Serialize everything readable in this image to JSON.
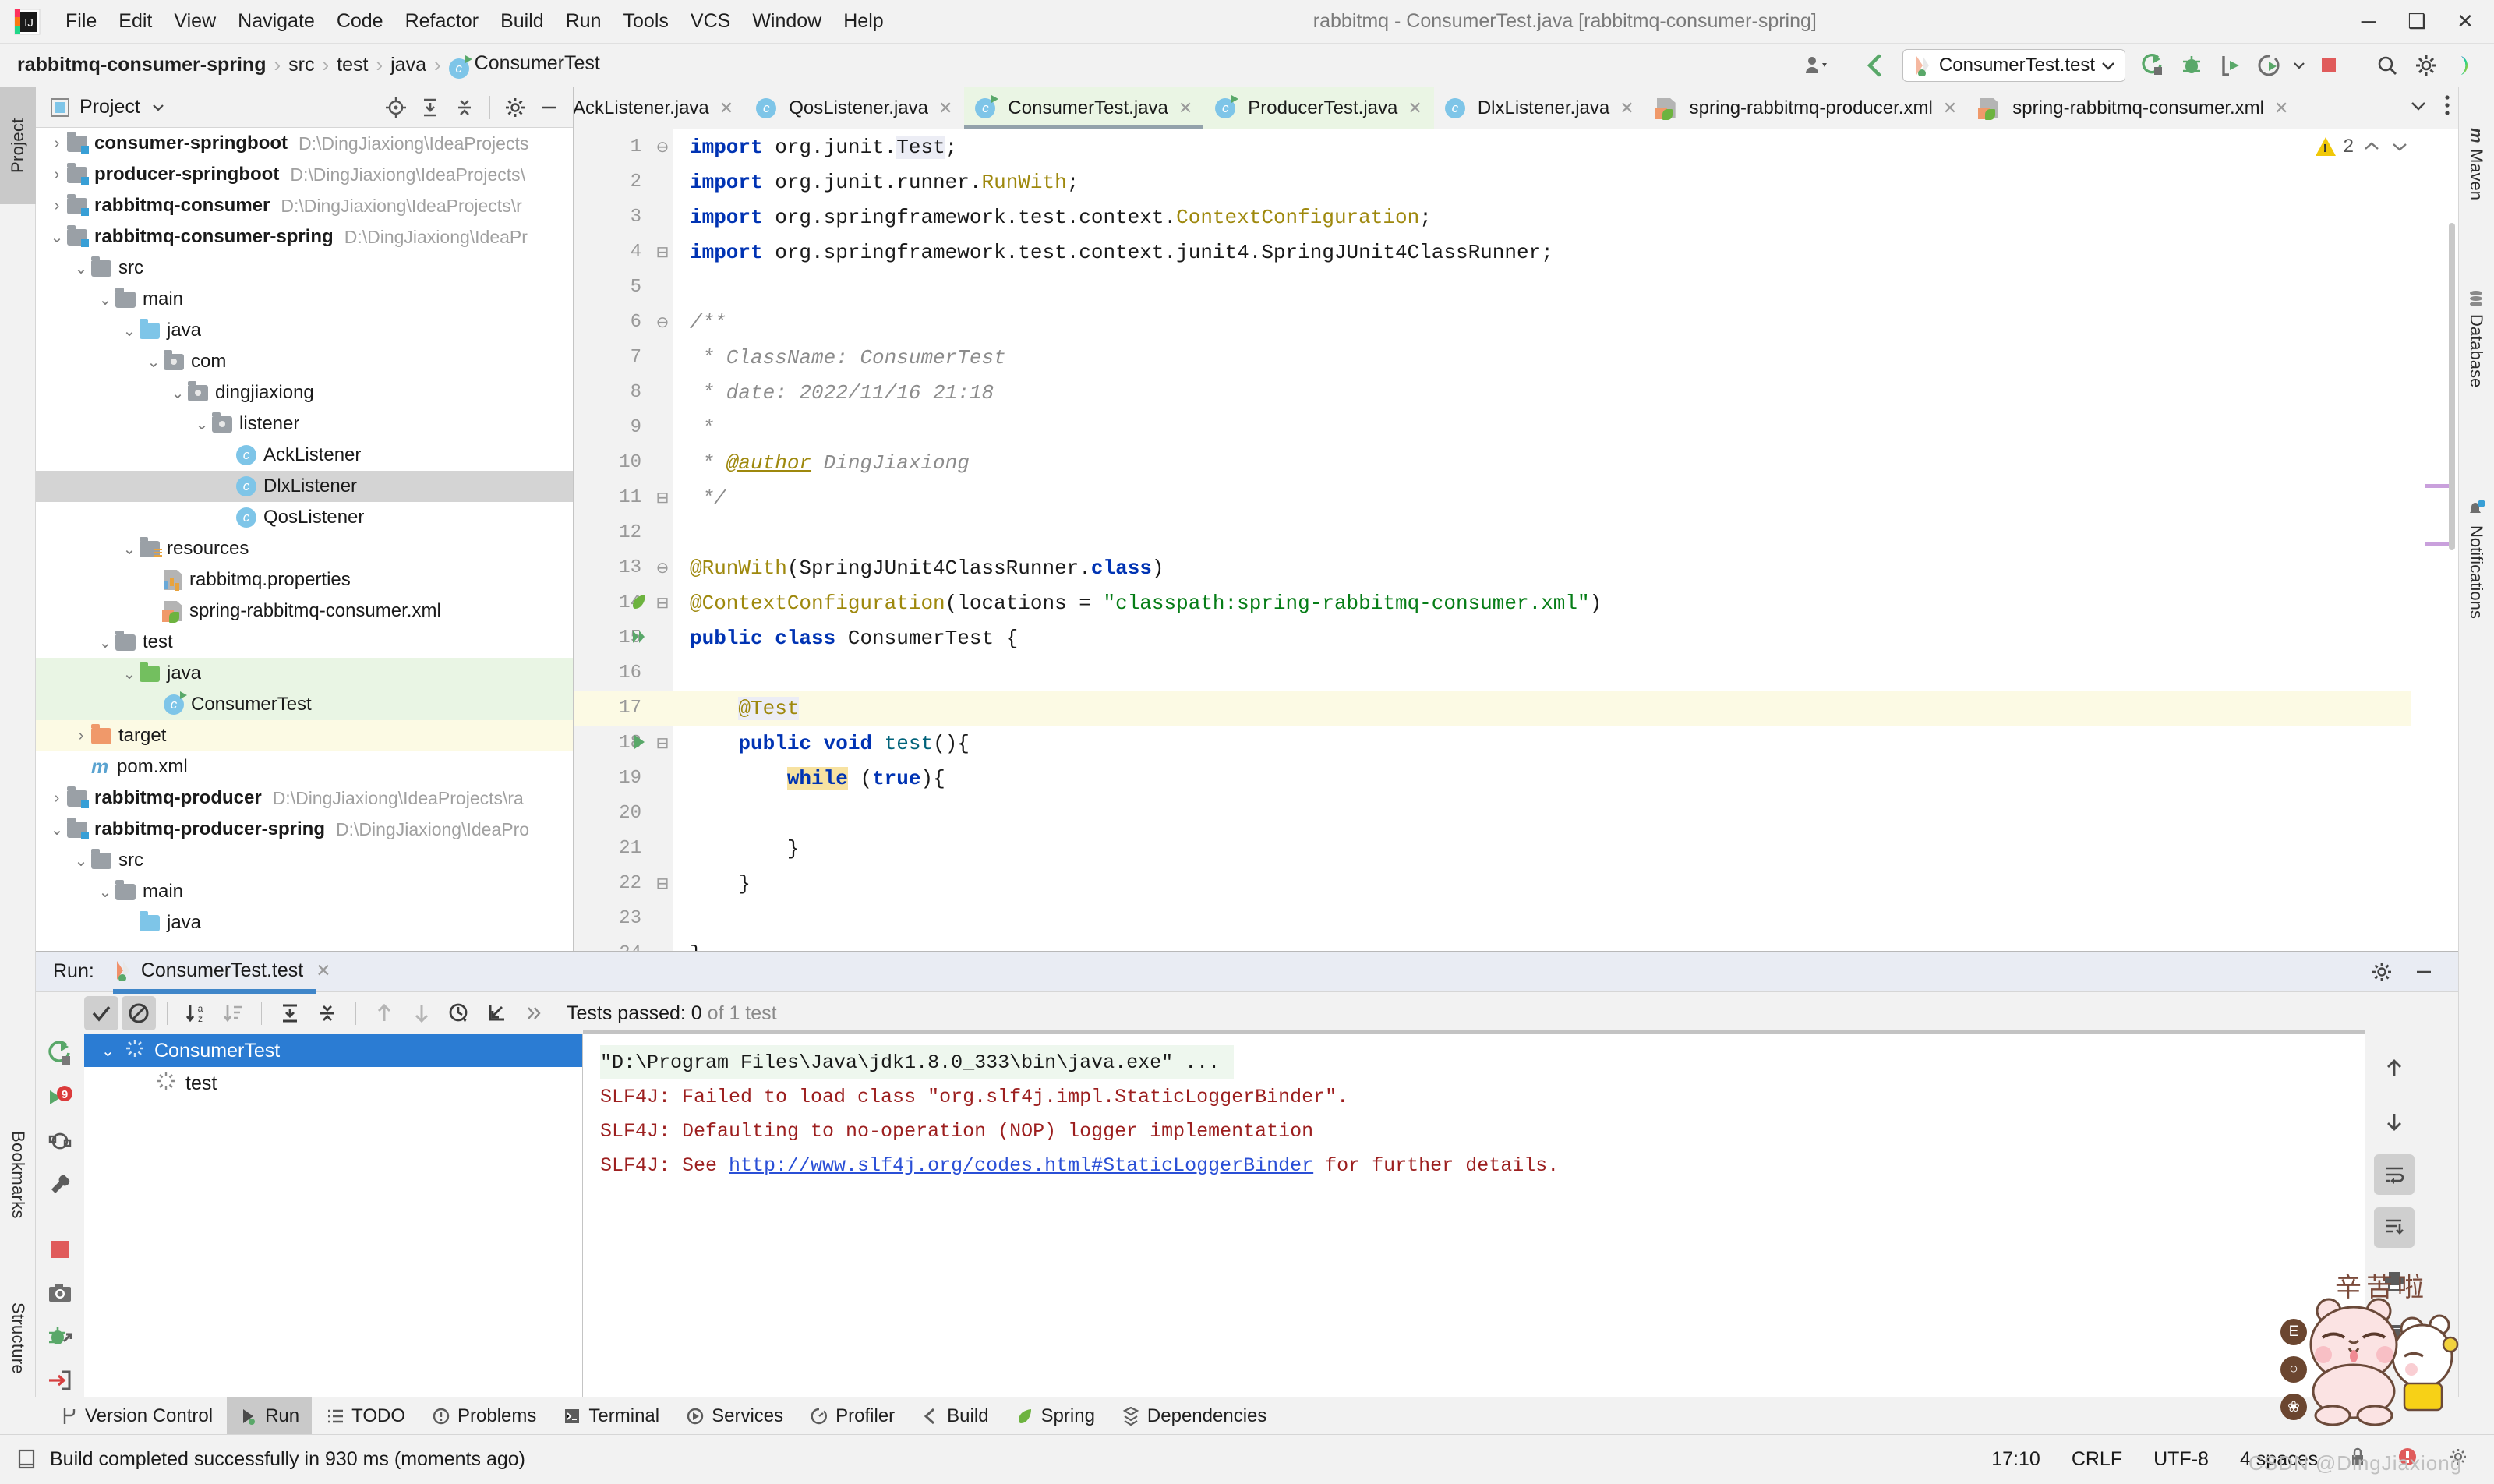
{
  "window": {
    "title": "rabbitmq - ConsumerTest.java [rabbitmq-consumer-spring]",
    "minimize": "─",
    "maximize": "❑",
    "close": "✕"
  },
  "menubar": {
    "items": [
      {
        "label": "File",
        "mnemonic": "F"
      },
      {
        "label": "Edit",
        "mnemonic": "E"
      },
      {
        "label": "View",
        "mnemonic": "V"
      },
      {
        "label": "Navigate",
        "mnemonic": "N"
      },
      {
        "label": "Code",
        "mnemonic": "C"
      },
      {
        "label": "Refactor",
        "mnemonic": "R"
      },
      {
        "label": "Build",
        "mnemonic": "B"
      },
      {
        "label": "Run",
        "mnemonic": "R"
      },
      {
        "label": "Tools",
        "mnemonic": "T"
      },
      {
        "label": "VCS",
        "mnemonic": "S"
      },
      {
        "label": "Window",
        "mnemonic": "W"
      },
      {
        "label": "Help",
        "mnemonic": "H"
      }
    ]
  },
  "breadcrumb": {
    "items": [
      {
        "label": "rabbitmq-consumer-spring",
        "bold": true,
        "icon": ""
      },
      {
        "label": "src",
        "bold": false,
        "icon": ""
      },
      {
        "label": "test",
        "bold": false,
        "icon": ""
      },
      {
        "label": "java",
        "bold": false,
        "icon": ""
      },
      {
        "label": "ConsumerTest",
        "bold": false,
        "icon": "class-icon"
      }
    ],
    "separator": "›"
  },
  "toolbar": {
    "run_config_label": "ConsumerTest.test",
    "icons": [
      "user-profile-icon",
      "vcs-update-icon",
      "run-icon",
      "debug-icon",
      "run-coverage-icon",
      "profile-icon",
      "stop-icon",
      "search-everywhere-icon",
      "settings-icon",
      "ide-assistant-icon"
    ]
  },
  "left_stripe": {
    "tabs": [
      {
        "label": "Project",
        "active": true
      },
      {
        "label": "Bookmarks",
        "active": false
      },
      {
        "label": "Structure",
        "active": false
      }
    ]
  },
  "right_stripe": {
    "tabs": [
      {
        "label": "Maven",
        "icon": "maven-icon"
      },
      {
        "label": "Database",
        "icon": "database-icon"
      },
      {
        "label": "Notifications",
        "icon": "bell-icon"
      }
    ]
  },
  "project_panel": {
    "title": "Project",
    "actions": [
      "locate-icon",
      "expand-all-icon",
      "collapse-all-icon",
      "gear-icon",
      "hide-icon"
    ],
    "tree": [
      {
        "depth": 0,
        "twig": "›",
        "icon": "module",
        "label": "consumer-springboot",
        "bold": true,
        "path": "D:\\DingJiaxiong\\IdeaProjects",
        "state": ""
      },
      {
        "depth": 0,
        "twig": "›",
        "icon": "module",
        "label": "producer-springboot",
        "bold": true,
        "path": "D:\\DingJiaxiong\\IdeaProjects\\",
        "state": ""
      },
      {
        "depth": 0,
        "twig": "›",
        "icon": "module",
        "label": "rabbitmq-consumer",
        "bold": true,
        "path": "D:\\DingJiaxiong\\IdeaProjects\\r",
        "state": ""
      },
      {
        "depth": 0,
        "twig": "⌄",
        "icon": "module",
        "label": "rabbitmq-consumer-spring",
        "bold": true,
        "path": "D:\\DingJiaxiong\\IdeaPr",
        "state": ""
      },
      {
        "depth": 1,
        "twig": "⌄",
        "icon": "folder",
        "label": "src",
        "bold": false,
        "path": "",
        "state": ""
      },
      {
        "depth": 2,
        "twig": "⌄",
        "icon": "folder",
        "label": "main",
        "bold": false,
        "path": "",
        "state": ""
      },
      {
        "depth": 3,
        "twig": "⌄",
        "icon": "folder-blue",
        "label": "java",
        "bold": false,
        "path": "",
        "state": ""
      },
      {
        "depth": 4,
        "twig": "⌄",
        "icon": "package",
        "label": "com",
        "bold": false,
        "path": "",
        "state": ""
      },
      {
        "depth": 5,
        "twig": "⌄",
        "icon": "package",
        "label": "dingjiaxiong",
        "bold": false,
        "path": "",
        "state": ""
      },
      {
        "depth": 6,
        "twig": "⌄",
        "icon": "package",
        "label": "listener",
        "bold": false,
        "path": "",
        "state": ""
      },
      {
        "depth": 7,
        "twig": "",
        "icon": "class",
        "label": "AckListener",
        "bold": false,
        "path": "",
        "state": ""
      },
      {
        "depth": 7,
        "twig": "",
        "icon": "class",
        "label": "DlxListener",
        "bold": false,
        "path": "",
        "state": "sel"
      },
      {
        "depth": 7,
        "twig": "",
        "icon": "class",
        "label": "QosListener",
        "bold": false,
        "path": "",
        "state": ""
      },
      {
        "depth": 3,
        "twig": "⌄",
        "icon": "folder-res",
        "label": "resources",
        "bold": false,
        "path": "",
        "state": ""
      },
      {
        "depth": 4,
        "twig": "",
        "icon": "props",
        "label": "rabbitmq.properties",
        "bold": false,
        "path": "",
        "state": ""
      },
      {
        "depth": 4,
        "twig": "",
        "icon": "xml",
        "label": "spring-rabbitmq-consumer.xml",
        "bold": false,
        "path": "",
        "state": ""
      },
      {
        "depth": 2,
        "twig": "⌄",
        "icon": "folder",
        "label": "test",
        "bold": false,
        "path": "",
        "state": ""
      },
      {
        "depth": 3,
        "twig": "⌄",
        "icon": "folder-green",
        "label": "java",
        "bold": false,
        "path": "",
        "state": "green"
      },
      {
        "depth": 4,
        "twig": "",
        "icon": "class-run",
        "label": "ConsumerTest",
        "bold": false,
        "path": "",
        "state": "green"
      },
      {
        "depth": 1,
        "twig": "›",
        "icon": "folder-orange",
        "label": "target",
        "bold": false,
        "path": "",
        "state": "yellow"
      },
      {
        "depth": 1,
        "twig": "",
        "icon": "maven",
        "label": "pom.xml",
        "bold": false,
        "path": "",
        "state": ""
      },
      {
        "depth": 0,
        "twig": "›",
        "icon": "module",
        "label": "rabbitmq-producer",
        "bold": true,
        "path": "D:\\DingJiaxiong\\IdeaProjects\\ra",
        "state": ""
      },
      {
        "depth": 0,
        "twig": "⌄",
        "icon": "module",
        "label": "rabbitmq-producer-spring",
        "bold": true,
        "path": "D:\\DingJiaxiong\\IdeaPro",
        "state": ""
      },
      {
        "depth": 1,
        "twig": "⌄",
        "icon": "folder",
        "label": "src",
        "bold": false,
        "path": "",
        "state": ""
      },
      {
        "depth": 2,
        "twig": "⌄",
        "icon": "folder",
        "label": "main",
        "bold": false,
        "path": "",
        "state": ""
      },
      {
        "depth": 3,
        "twig": "",
        "icon": "folder-blue",
        "label": "java",
        "bold": false,
        "path": "",
        "state": ""
      }
    ]
  },
  "editor_tabs": {
    "items": [
      {
        "label": "AckListener.java",
        "icon": "class-icon",
        "state": "clipped"
      },
      {
        "label": "QosListener.java",
        "icon": "class-icon",
        "state": ""
      },
      {
        "label": "ConsumerTest.java",
        "icon": "class-run-icon",
        "state": "current"
      },
      {
        "label": "ProducerTest.java",
        "icon": "class-run-icon",
        "state": "active"
      },
      {
        "label": "DlxListener.java",
        "icon": "class-icon",
        "state": ""
      },
      {
        "label": "spring-rabbitmq-producer.xml",
        "icon": "xml-spring-icon",
        "state": ""
      },
      {
        "label": "spring-rabbitmq-consumer.xml",
        "icon": "xml-spring-icon",
        "state": ""
      }
    ],
    "close_glyph": "✕",
    "controls": [
      "chevron-down-icon",
      "more-options-icon"
    ]
  },
  "editor": {
    "warning_count": "2",
    "lines": [
      {
        "n": "1",
        "fold": "⊖",
        "html": "<span class=\"kw\">import</span> org.junit.<span class=\"hl-id\">Test</span>;",
        "hl": false,
        "gutter": ""
      },
      {
        "n": "2",
        "fold": "",
        "html": "<span class=\"kw\">import</span> org.junit.runner.<span class=\"ann\">RunWith</span>;",
        "hl": false,
        "gutter": ""
      },
      {
        "n": "3",
        "fold": "",
        "html": "<span class=\"kw\">import</span> org.springframework.test.context.<span class=\"ann\">ContextConfiguration</span>;",
        "hl": false,
        "gutter": ""
      },
      {
        "n": "4",
        "fold": "⊟",
        "html": "<span class=\"kw\">import</span> org.springframework.test.context.junit4.SpringJUnit4ClassRunner;",
        "hl": false,
        "gutter": ""
      },
      {
        "n": "5",
        "fold": "",
        "html": "",
        "hl": false,
        "gutter": ""
      },
      {
        "n": "6",
        "fold": "⊖",
        "html": "<span class=\"cmt\">/**</span>",
        "hl": false,
        "gutter": ""
      },
      {
        "n": "7",
        "fold": "",
        "html": "<span class=\"cmt\"> * ClassName: ConsumerTest</span>",
        "hl": false,
        "gutter": ""
      },
      {
        "n": "8",
        "fold": "",
        "html": "<span class=\"cmt\"> * date: 2022/11/16 21:18</span>",
        "hl": false,
        "gutter": ""
      },
      {
        "n": "9",
        "fold": "",
        "html": "<span class=\"cmt\"> *</span>",
        "hl": false,
        "gutter": ""
      },
      {
        "n": "10",
        "fold": "",
        "html": "<span class=\"cmt\"> * </span><span class=\"atag\">@author</span><span class=\"cmt\"> DingJiaxiong</span>",
        "hl": false,
        "gutter": ""
      },
      {
        "n": "11",
        "fold": "⊟",
        "html": "<span class=\"cmt\"> */</span>",
        "hl": false,
        "gutter": ""
      },
      {
        "n": "12",
        "fold": "",
        "html": "",
        "hl": false,
        "gutter": ""
      },
      {
        "n": "13",
        "fold": "⊖",
        "html": "<span class=\"ann\">@RunWith</span>(SpringJUnit4ClassRunner.<span class=\"kw\">class</span>)",
        "hl": false,
        "gutter": ""
      },
      {
        "n": "14",
        "fold": "⊟",
        "html": "<span class=\"ann\">@ContextConfiguration</span>(locations = <span class=\"str\">\"classpath:spring-rabbitmq-consumer.xml\"</span>)",
        "hl": false,
        "gutter": "spring-leaf-icon"
      },
      {
        "n": "15",
        "fold": "",
        "html": "<span class=\"kw\">public class</span> ConsumerTest {",
        "hl": false,
        "gutter": "run-all-icon"
      },
      {
        "n": "16",
        "fold": "",
        "html": "",
        "hl": false,
        "gutter": ""
      },
      {
        "n": "17",
        "fold": "",
        "html": "    <span class=\"ann hl-id\">@Test</span>",
        "hl": true,
        "gutter": ""
      },
      {
        "n": "18",
        "fold": "⊟",
        "html": "    <span class=\"kw\">public void</span> <span class=\"mth\">test</span>(){",
        "hl": false,
        "gutter": "run-method-icon"
      },
      {
        "n": "19",
        "fold": "",
        "html": "        <span class=\"kw hl-kw\">while</span> (<span class=\"kw\">true</span>){",
        "hl": false,
        "gutter": ""
      },
      {
        "n": "20",
        "fold": "",
        "html": "",
        "hl": false,
        "gutter": ""
      },
      {
        "n": "21",
        "fold": "",
        "html": "        }",
        "hl": false,
        "gutter": ""
      },
      {
        "n": "22",
        "fold": "⊟",
        "html": "    }",
        "hl": false,
        "gutter": ""
      },
      {
        "n": "23",
        "fold": "",
        "html": "",
        "hl": false,
        "gutter": ""
      },
      {
        "n": "24",
        "fold": "",
        "html": "}",
        "hl": false,
        "gutter": ""
      }
    ]
  },
  "run_panel": {
    "run_label": "Run:",
    "tab_label": "ConsumerTest.test",
    "close_glyph": "✕",
    "tests_status_main": "Tests passed: 0",
    "tests_status_dim": " of 1 test",
    "toolbar_icons": [
      "show-passed-icon",
      "show-ignored-icon",
      "sort-alphabetically-icon",
      "sort-by-duration-icon",
      "expand-all-icon",
      "collapse-all-icon",
      "prev-failed-icon",
      "next-failed-icon",
      "history-icon",
      "import-tests-icon",
      "more-icon"
    ],
    "left_gutter_icons": [
      "rerun-icon",
      "rerun-failed-icon",
      "toggle-auto-test-icon",
      "test-settings-icon",
      "stop-icon",
      "screenshot-icon",
      "debug-icon",
      "export-icon"
    ],
    "right_gutter_icons": [
      "scroll-up-icon",
      "scroll-down-icon",
      "soft-wrap-icon",
      "scroll-to-end-icon",
      "print-icon",
      "clear-all-icon"
    ],
    "test_tree": [
      {
        "label": "ConsumerTest",
        "icon": "running-icon",
        "twig": "⌄",
        "selected": true
      },
      {
        "label": "test",
        "icon": "running-icon",
        "twig": "",
        "selected": false
      }
    ],
    "console": [
      {
        "text": "\"D:\\Program Files\\Java\\jdk1.8.0_333\\bin\\java.exe\" ...",
        "kind": "ok"
      },
      {
        "text": "SLF4J: Failed to load class \"org.slf4j.impl.StaticLoggerBinder\".",
        "kind": "err"
      },
      {
        "text": "SLF4J: Defaulting to no-operation (NOP) logger implementation",
        "kind": "err"
      },
      {
        "text": "SLF4J: See ",
        "kind": "err",
        "link": "http://www.slf4j.org/codes.html#StaticLoggerBinder",
        "after": " for further details."
      }
    ]
  },
  "bottom_tabs": {
    "items": [
      {
        "label": "Version Control",
        "icon": "branch-icon",
        "active": false
      },
      {
        "label": "Run",
        "icon": "run-icon",
        "active": true
      },
      {
        "label": "TODO",
        "icon": "todo-icon",
        "active": false
      },
      {
        "label": "Problems",
        "icon": "problems-icon",
        "active": false
      },
      {
        "label": "Terminal",
        "icon": "terminal-icon",
        "active": false
      },
      {
        "label": "Services",
        "icon": "services-icon",
        "active": false
      },
      {
        "label": "Profiler",
        "icon": "profiler-icon",
        "active": false
      },
      {
        "label": "Build",
        "icon": "build-icon",
        "active": false
      },
      {
        "label": "Spring",
        "icon": "spring-icon",
        "active": false
      },
      {
        "label": "Dependencies",
        "icon": "dependencies-icon",
        "active": false
      }
    ]
  },
  "statusbar": {
    "message": "Build completed successfully in 930 ms (moments ago)",
    "icon": "event-log-icon",
    "right": [
      "17:10",
      "CRLF",
      "UTF-8",
      "4 spaces"
    ],
    "indicators": [
      "lock-icon",
      "inspection-error-icon",
      "gear-icon"
    ]
  },
  "decor": {
    "watermark": "CSDN @DingJiaxiong",
    "sticker_text": "辛苦啦",
    "sticker_stamps": [
      "E",
      "○",
      "❀"
    ]
  },
  "colors": {
    "accent_blue": "#2b7cd3",
    "green_tab": "#eaf5e4",
    "error_red": "#9c1f1f",
    "string_green": "#067d17",
    "keyword_blue": "#0033b3",
    "annotation_gold": "#9e880d",
    "warning_yellow": "#f0c808"
  }
}
